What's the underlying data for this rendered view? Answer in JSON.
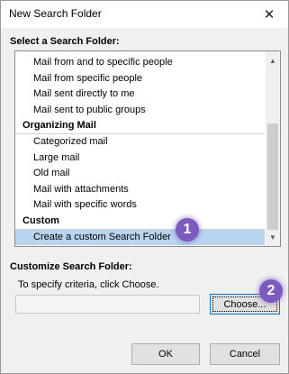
{
  "window": {
    "title": "New Search Folder",
    "close_glyph": "✕"
  },
  "select_section": {
    "label": "Select a Search Folder:"
  },
  "list": {
    "rows": [
      {
        "type": "item",
        "label": "Mail from and to specific people"
      },
      {
        "type": "item",
        "label": "Mail from specific people"
      },
      {
        "type": "item",
        "label": "Mail sent directly to me"
      },
      {
        "type": "item",
        "label": "Mail sent to public groups"
      },
      {
        "type": "group",
        "label": "Organizing Mail"
      },
      {
        "type": "item",
        "label": "Categorized mail"
      },
      {
        "type": "item",
        "label": "Large mail"
      },
      {
        "type": "item",
        "label": "Old mail"
      },
      {
        "type": "item",
        "label": "Mail with attachments"
      },
      {
        "type": "item",
        "label": "Mail with specific words"
      },
      {
        "type": "group",
        "label": "Custom"
      },
      {
        "type": "item",
        "label": "Create a custom Search Folder",
        "selected": true
      }
    ],
    "scroll_up_glyph": "▲",
    "scroll_down_glyph": "▼"
  },
  "customize_section": {
    "label": "Customize Search Folder:",
    "description": "To specify criteria, click Choose.",
    "criteria_value": ""
  },
  "buttons": {
    "choose": "Choose...",
    "ok": "OK",
    "cancel": "Cancel"
  },
  "annotations": {
    "badge_1": "1",
    "badge_2": "2"
  },
  "colors": {
    "selection": "#b9d4ef",
    "badge": "#7b5bbd",
    "focus_border": "#0078d7"
  }
}
